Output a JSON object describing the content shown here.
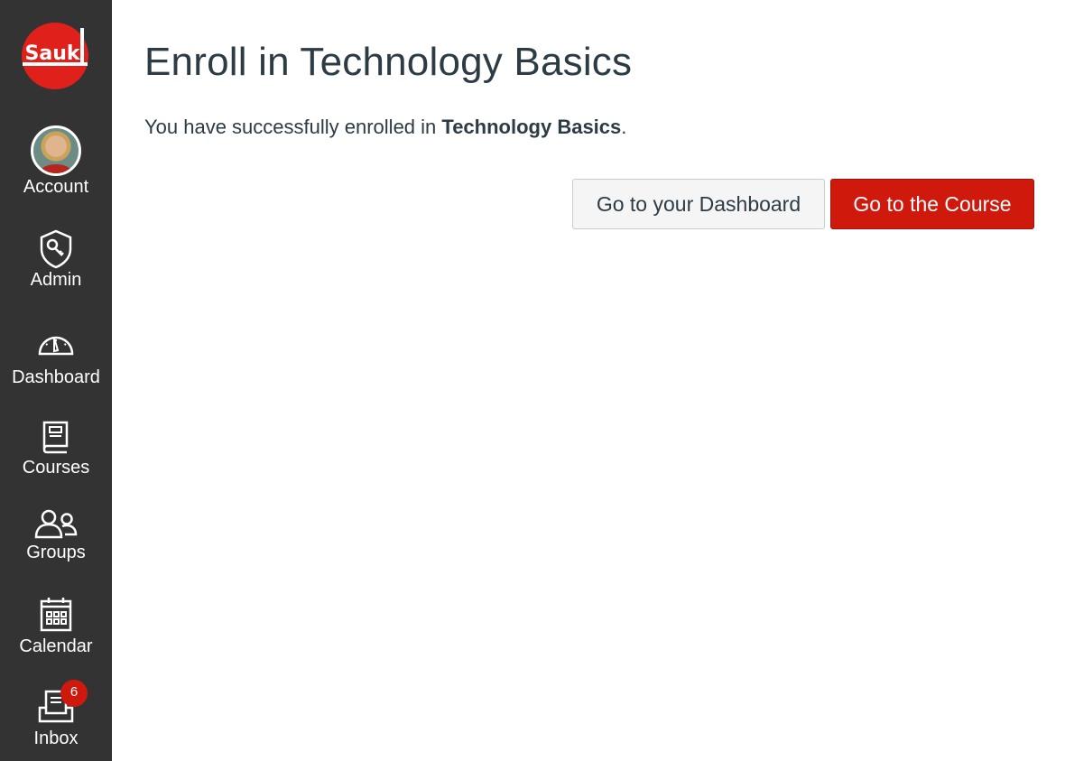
{
  "sidebar": {
    "logo": {
      "text": "Sauk",
      "icon": "sauk-logo",
      "color": "#e0201b"
    },
    "items": [
      {
        "label": "Account",
        "icon": "avatar"
      },
      {
        "label": "Admin",
        "icon": "shield-key-icon"
      },
      {
        "label": "Dashboard",
        "icon": "speedometer-icon"
      },
      {
        "label": "Courses",
        "icon": "book-icon"
      },
      {
        "label": "Groups",
        "icon": "users-icon"
      },
      {
        "label": "Calendar",
        "icon": "calendar-icon"
      },
      {
        "label": "Inbox",
        "icon": "inbox-icon",
        "badge": "6"
      }
    ]
  },
  "main": {
    "title": "Enroll in Technology Basics",
    "message_prefix": "You have successfully enrolled in ",
    "message_course": "Technology Basics",
    "message_suffix": ".",
    "buttons": {
      "dashboard": "Go to your Dashboard",
      "course": "Go to the Course"
    }
  },
  "colors": {
    "sidebar_bg": "#333333",
    "primary": "#d0190d",
    "text": "#2d3b45"
  }
}
